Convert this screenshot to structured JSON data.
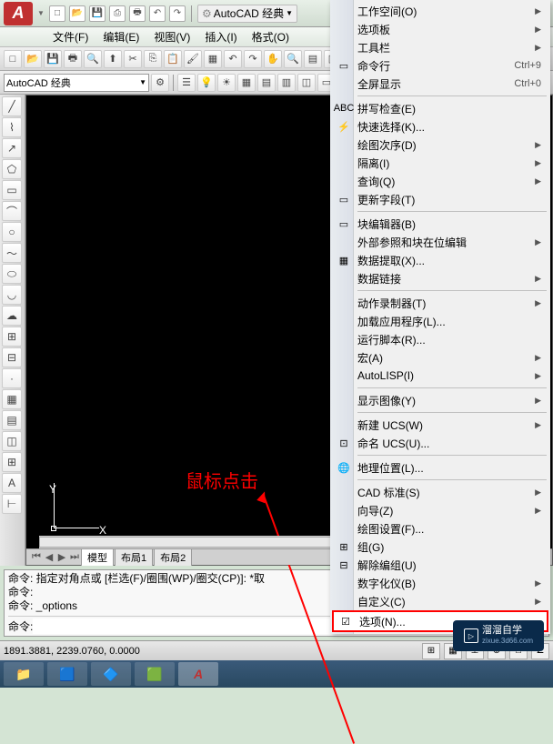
{
  "titlebar": {
    "logo": "A",
    "workspace_label": "AutoCAD 经典"
  },
  "menubar": {
    "items": [
      {
        "label": "文件(F)"
      },
      {
        "label": "编辑(E)"
      },
      {
        "label": "视图(V)"
      },
      {
        "label": "插入(I)"
      },
      {
        "label": "格式(O)"
      }
    ]
  },
  "workspace_combo": "AutoCAD 经典",
  "drawing": {
    "ucs_y": "Y",
    "ucs_x": "X",
    "annotation": "鼠标点击"
  },
  "tabs": {
    "items": [
      "模型",
      "布局1",
      "布局2"
    ]
  },
  "command": {
    "line1": "命令: 指定对角点或 [栏选(F)/圈围(WP)/圈交(CP)]: *取",
    "line2": "命令:",
    "line3": "命令: _options",
    "prompt": "命令:"
  },
  "statusbar": {
    "coords": "1891.3881, 2239.0760, 0.0000"
  },
  "context_menu": {
    "items": [
      {
        "label": "工作空间(O)",
        "arrow": true
      },
      {
        "label": "选项板",
        "arrow": true
      },
      {
        "label": "工具栏",
        "arrow": true
      },
      {
        "label": "命令行",
        "shortcut": "Ctrl+9",
        "icon": "▭"
      },
      {
        "label": "全屏显示",
        "shortcut": "Ctrl+0"
      },
      {
        "sep": true
      },
      {
        "label": "拼写检查(E)",
        "icon": "ABC"
      },
      {
        "label": "快速选择(K)...",
        "icon": "⚡"
      },
      {
        "label": "绘图次序(D)",
        "arrow": true
      },
      {
        "label": "隔离(I)",
        "arrow": true
      },
      {
        "label": "查询(Q)",
        "arrow": true
      },
      {
        "label": "更新字段(T)",
        "icon": "▭"
      },
      {
        "sep": true
      },
      {
        "label": "块编辑器(B)",
        "icon": "▭"
      },
      {
        "label": "外部参照和块在位编辑",
        "arrow": true
      },
      {
        "label": "数据提取(X)...",
        "icon": "▦"
      },
      {
        "label": "数据链接",
        "arrow": true
      },
      {
        "sep": true
      },
      {
        "label": "动作录制器(T)",
        "arrow": true
      },
      {
        "label": "加载应用程序(L)..."
      },
      {
        "label": "运行脚本(R)..."
      },
      {
        "label": "宏(A)",
        "arrow": true
      },
      {
        "label": "AutoLISP(I)",
        "arrow": true
      },
      {
        "sep": true
      },
      {
        "label": "显示图像(Y)",
        "arrow": true
      },
      {
        "sep": true
      },
      {
        "label": "新建 UCS(W)",
        "arrow": true
      },
      {
        "label": "命名 UCS(U)...",
        "icon": "⊡"
      },
      {
        "sep": true
      },
      {
        "label": "地理位置(L)...",
        "icon": "🌐"
      },
      {
        "sep": true
      },
      {
        "label": "CAD 标准(S)",
        "arrow": true
      },
      {
        "label": "向导(Z)",
        "arrow": true
      },
      {
        "label": "绘图设置(F)..."
      },
      {
        "label": "组(G)",
        "icon": "⊞"
      },
      {
        "label": "解除编组(U)",
        "icon": "⊟"
      },
      {
        "label": "数字化仪(B)",
        "arrow": true
      },
      {
        "label": "自定义(C)",
        "arrow": true
      },
      {
        "label": "选项(N)...",
        "icon": "☑",
        "highlighted": true
      }
    ]
  },
  "watermark": {
    "main": "溜溜自学",
    "sub": "zixue.3d66.com"
  }
}
